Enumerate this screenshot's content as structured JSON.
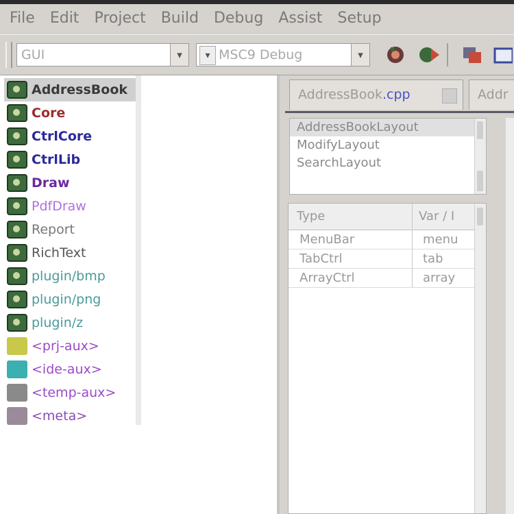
{
  "menu": [
    "File",
    "Edit",
    "Project",
    "Build",
    "Debug",
    "Assist",
    "Setup"
  ],
  "toolbar": {
    "package_combo": "GUI",
    "config_combo": "MSC9 Debug"
  },
  "tree": {
    "items": [
      {
        "label": "AddressBook",
        "color": "#3a3a3a",
        "icon": "package-icon",
        "bold": true,
        "selected": true
      },
      {
        "label": "Core",
        "color": "#9b2d2d",
        "icon": "package-icon",
        "bold": true
      },
      {
        "label": "CtrlCore",
        "color": "#2a2a9a",
        "icon": "package-icon",
        "bold": true
      },
      {
        "label": "CtrlLib",
        "color": "#2a2a9a",
        "icon": "package-icon",
        "bold": true
      },
      {
        "label": "Draw",
        "color": "#6a2aa0",
        "icon": "package-icon",
        "bold": true
      },
      {
        "label": "PdfDraw",
        "color": "#b070e0",
        "icon": "package-icon",
        "bold": false
      },
      {
        "label": "Report",
        "color": "#777777",
        "icon": "package-icon",
        "bold": false
      },
      {
        "label": "RichText",
        "color": "#555555",
        "icon": "package-icon",
        "bold": false
      },
      {
        "label": "plugin/bmp",
        "color": "#4a9a9a",
        "icon": "package-icon",
        "bold": false
      },
      {
        "label": "plugin/png",
        "color": "#4a9a9a",
        "icon": "package-icon",
        "bold": false
      },
      {
        "label": "plugin/z",
        "color": "#4a9a9a",
        "icon": "package-icon",
        "bold": false
      },
      {
        "label": "<prj-aux>",
        "color": "#9a4ac8",
        "icon": "folder-icon",
        "iconColor": "#c8c84a"
      },
      {
        "label": "<ide-aux>",
        "color": "#9a4ac8",
        "icon": "folder-icon",
        "iconColor": "#3ab0b0"
      },
      {
        "label": "<temp-aux>",
        "color": "#9a4ac8",
        "icon": "folder-icon",
        "iconColor": "#8a8a8a"
      },
      {
        "label": "<meta>",
        "color": "#8a4ab8",
        "icon": "folder-icon",
        "iconColor": "#9a8a9a"
      }
    ]
  },
  "tabs": [
    {
      "label": "AddressBook",
      "ext": ".cpp"
    },
    {
      "label": "Addr",
      "ext": ""
    }
  ],
  "layouts": [
    "AddressBookLayout",
    "ModifyLayout",
    "SearchLayout"
  ],
  "table": {
    "headers": [
      "Type",
      "Var / I"
    ],
    "rows": [
      [
        "MenuBar",
        "menu"
      ],
      [
        "TabCtrl",
        "tab"
      ],
      [
        "ArrayCtrl",
        "array"
      ]
    ]
  }
}
